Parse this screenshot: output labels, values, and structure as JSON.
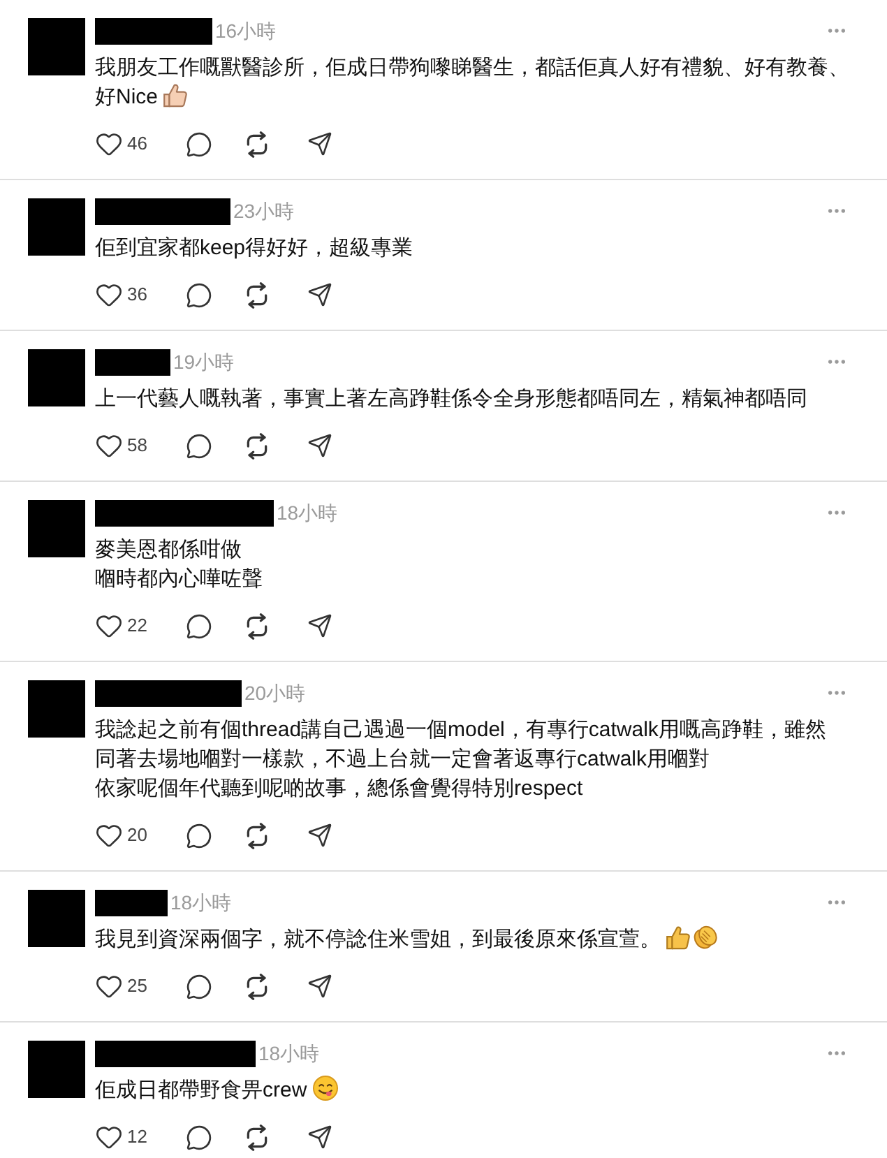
{
  "comments": [
    {
      "time": "16小時",
      "lines": [
        "我朋友工作嘅獸醫診所，佢成日帶狗嚟睇醫生，都話佢真人好有禮貌、好有教養、",
        "好Nice"
      ],
      "emoji": [
        {
          "kind": "thumbs_up_light"
        }
      ],
      "likes": "46"
    },
    {
      "time": "23小時",
      "lines": [
        "佢到宜家都keep得好好，超級專業"
      ],
      "likes": "36"
    },
    {
      "time": "19小時",
      "lines": [
        "上一代藝人嘅執著，事實上著左高踭鞋係令全身形態都唔同左，精氣神都唔同"
      ],
      "likes": "58"
    },
    {
      "time": "18小時",
      "lines": [
        "麥美恩都係咁做",
        "嗰時都內心嘩咗聲"
      ],
      "likes": "22"
    },
    {
      "time": "20小時",
      "lines": [
        "我諗起之前有個thread講自己遇過一個model，有專行catwalk用嘅高踭鞋，雖然",
        "同著去場地嗰對一樣款，不過上台就一定會著返專行catwalk用嗰對",
        "依家呢個年代聽到呢啲故事，總係會覺得特別respect"
      ],
      "likes": "20"
    },
    {
      "time": "18小時",
      "lines": [
        "我見到資深兩個字，就不停諗住米雪姐，到最後原來係宣萱。"
      ],
      "emoji": [
        {
          "kind": "thumbs_up"
        },
        {
          "kind": "clapping_hands"
        }
      ],
      "likes": "25"
    },
    {
      "time": "18小時",
      "lines": [
        "佢成日都帶野食畀crew"
      ],
      "emoji": [
        {
          "kind": "yum_face"
        }
      ],
      "likes": "12"
    }
  ]
}
